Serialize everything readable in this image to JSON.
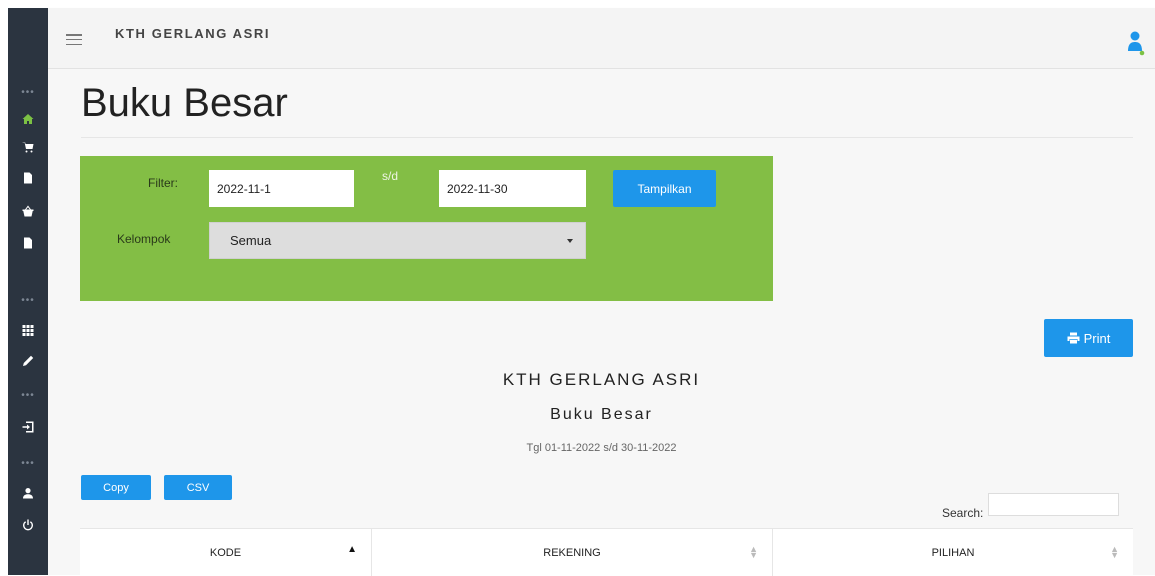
{
  "app": {
    "brand": "KTH GERLANG ASRI"
  },
  "page": {
    "title": "Buku Besar"
  },
  "filter": {
    "filter_label": "Filter:",
    "date_from": "2022-11-1",
    "range_sep": "s/d",
    "date_to": "2022-11-30",
    "submit_label": "Tampilkan",
    "group_label": "Kelompok",
    "group_selected": "Semua"
  },
  "print_label": "Print",
  "report": {
    "org": "KTH GERLANG ASRI",
    "title": "Buku Besar",
    "period": "Tgl 01-11-2022 s/d 30-11-2022"
  },
  "export": {
    "copy_label": "Copy",
    "csv_label": "CSV"
  },
  "search": {
    "label": "Search:"
  },
  "table": {
    "columns": [
      "KODE",
      "REKENING",
      "PILIHAN"
    ]
  },
  "sidebar": {
    "active_color": "#7cc144",
    "bg_color": "#2b3440"
  },
  "colors": {
    "accent": "#1e96ea",
    "panel": "#83be45"
  }
}
